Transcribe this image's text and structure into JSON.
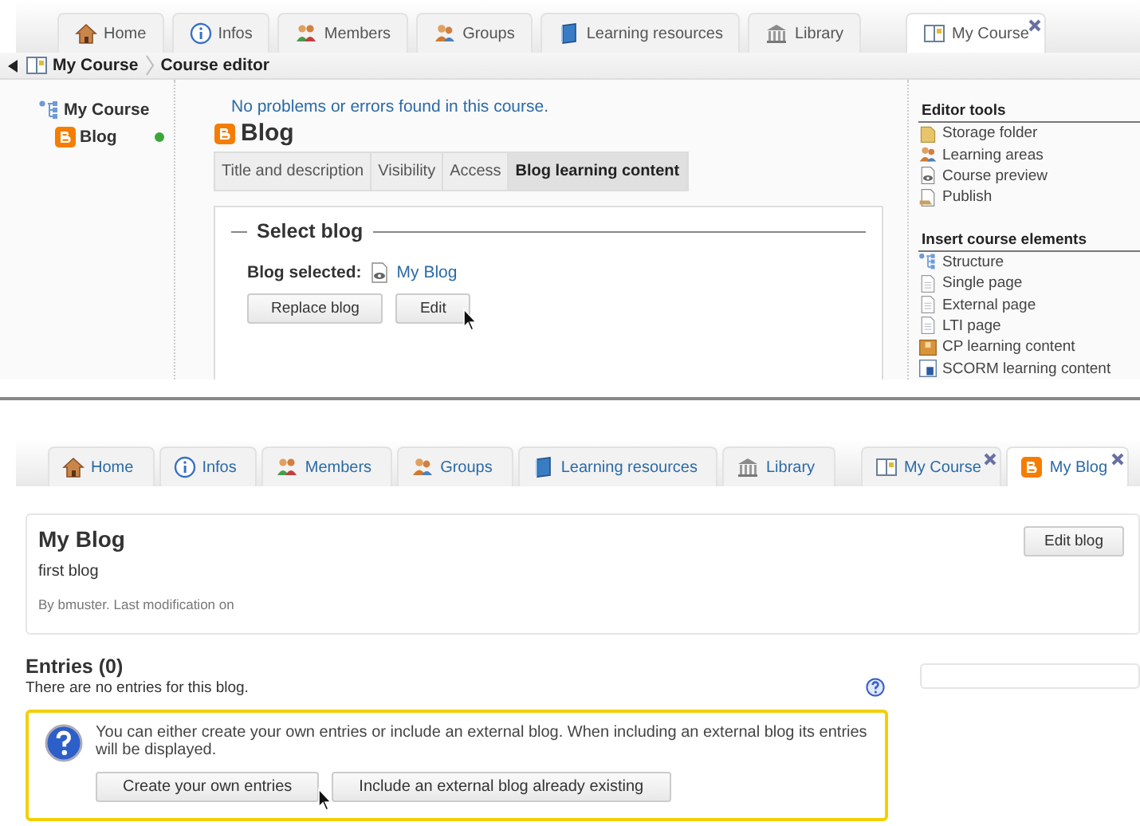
{
  "course_editor": {
    "tabs": [
      {
        "label": "Home",
        "kind": "house",
        "selected": false
      },
      {
        "label": "Infos",
        "kind": "info",
        "selected": false
      },
      {
        "label": "Members",
        "kind": "members",
        "selected": false
      },
      {
        "label": "Groups",
        "kind": "groups",
        "selected": false
      },
      {
        "label": "Learning resources",
        "kind": "book",
        "selected": false
      },
      {
        "label": "Library",
        "kind": "library",
        "selected": false
      }
    ],
    "course_tabs": [
      {
        "label": "My Course",
        "kind": "course",
        "selected": true,
        "closable": true
      }
    ],
    "breadcrumb": [
      {
        "label": "My Course",
        "kind": "course"
      },
      {
        "label": "Course editor"
      }
    ],
    "tree": [
      {
        "label": "My Course",
        "kind": "structure",
        "children": [
          {
            "label": "Blog",
            "kind": "blog",
            "status_ok": true
          }
        ]
      }
    ],
    "message": "No problems or errors found in this course.",
    "element_title": "Blog",
    "subtabs": [
      {
        "label": "Title and description",
        "selected": false
      },
      {
        "label": "Visibility",
        "selected": false
      },
      {
        "label": "Access",
        "selected": false
      },
      {
        "label": "Blog learning content",
        "selected": true
      }
    ],
    "fieldset_legend": "Select blog",
    "blog_selected_label": "Blog selected:",
    "blog_selected_value": "My Blog",
    "buttons": [
      "Replace blog",
      "Edit"
    ],
    "sidebar": [
      {
        "heading": "Editor tools",
        "items": [
          {
            "label": "Storage folder",
            "kind": "folder"
          },
          {
            "label": "Learning areas",
            "kind": "groups"
          },
          {
            "label": "Course preview",
            "kind": "preview"
          },
          {
            "label": "Publish",
            "kind": "publish"
          }
        ]
      },
      {
        "heading": "Insert course elements",
        "items": [
          {
            "label": "Structure",
            "kind": "structure"
          },
          {
            "label": "Single page",
            "kind": "page"
          },
          {
            "label": "External page",
            "kind": "page"
          },
          {
            "label": "LTI page",
            "kind": "page"
          },
          {
            "label": "CP learning content",
            "kind": "cp"
          },
          {
            "label": "SCORM learning content",
            "kind": "scorm"
          }
        ]
      }
    ]
  },
  "blog_view": {
    "tabs": [
      {
        "label": "Home",
        "kind": "house",
        "selected": false
      },
      {
        "label": "Infos",
        "kind": "info",
        "selected": false
      },
      {
        "label": "Members",
        "kind": "members",
        "selected": false
      },
      {
        "label": "Groups",
        "kind": "groups",
        "selected": false
      },
      {
        "label": "Learning resources",
        "kind": "book",
        "selected": false
      },
      {
        "label": "Library",
        "kind": "library",
        "selected": false
      }
    ],
    "course_tabs": [
      {
        "label": "My Course",
        "kind": "course",
        "selected": false,
        "closable": true
      },
      {
        "label": "My Blog",
        "kind": "blog",
        "selected": true,
        "closable": true
      }
    ],
    "blog_title": "My Blog",
    "blog_description": "first blog",
    "blog_meta": "By bmuster. Last modification on",
    "edit_button": "Edit blog",
    "entries_heading": "Entries (0)",
    "entries_empty": "There are no entries for this blog.",
    "info_text": "You can either create your own entries or include an external blog. When including an external blog its entries will be displayed.",
    "info_buttons": [
      "Create your own entries",
      "Include an external blog already existing"
    ]
  }
}
